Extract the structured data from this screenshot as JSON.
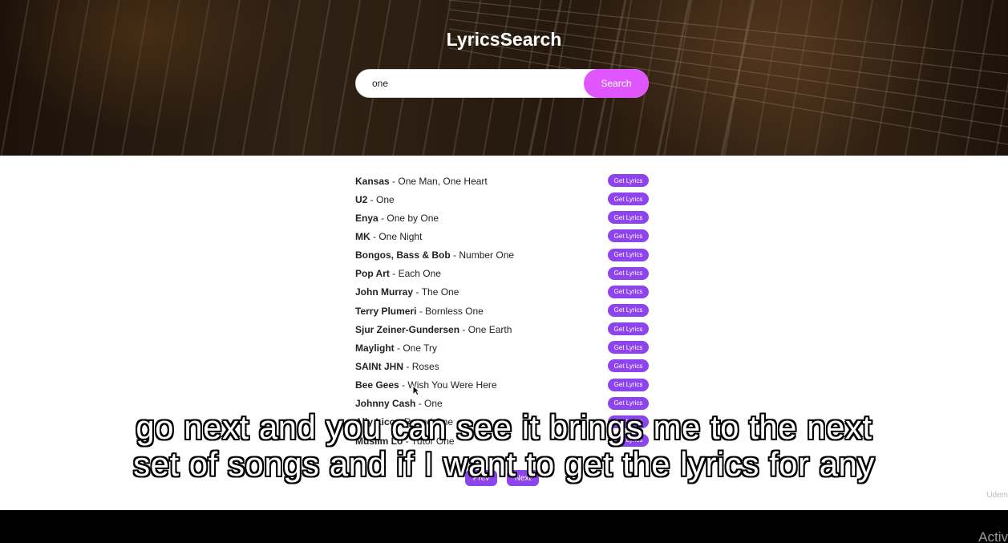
{
  "app": {
    "title": "LyricsSearch"
  },
  "search": {
    "value": "one",
    "button_label": "Search"
  },
  "songs": [
    {
      "artist": "Kansas",
      "title": "One Man, One Heart"
    },
    {
      "artist": "U2",
      "title": "One"
    },
    {
      "artist": "Enya",
      "title": "One by One"
    },
    {
      "artist": "MK",
      "title": "One Night"
    },
    {
      "artist": "Bongos, Bass & Bob",
      "title": "Number One"
    },
    {
      "artist": "Pop Art",
      "title": "Each One"
    },
    {
      "artist": "John Murray",
      "title": "The One"
    },
    {
      "artist": "Terry Plumeri",
      "title": "Bornless One"
    },
    {
      "artist": "Sjur Zeiner-Gundersen",
      "title": "One Earth"
    },
    {
      "artist": "Maylight",
      "title": "One Try"
    },
    {
      "artist": "SAINt JHN",
      "title": "Roses"
    },
    {
      "artist": "Bee Gees",
      "title": "Wish You Were Here"
    },
    {
      "artist": "Johnny Cash",
      "title": "One"
    },
    {
      "artist": "Ally Lico",
      "title": "Round One"
    },
    {
      "artist": "Muslim Lo",
      "title": "Tutor One"
    }
  ],
  "song_separator": " - ",
  "get_lyrics_label": "Get Lyrics",
  "pagination": {
    "prev_label": "Prev",
    "next_label": "Next"
  },
  "caption": {
    "line1": "go next and you can see it brings me to the next",
    "line2": "set of songs and if I want to get the lyrics for any"
  },
  "watermark": "Udem",
  "os_notice": "Activ",
  "colors": {
    "search_button": "#e056fd",
    "lyrics_button": "#8e44ec",
    "page_background": "#ffffff"
  },
  "icons": {
    "cursor": "cursor-arrow-icon",
    "watermark": "udemy-logo-icon"
  }
}
